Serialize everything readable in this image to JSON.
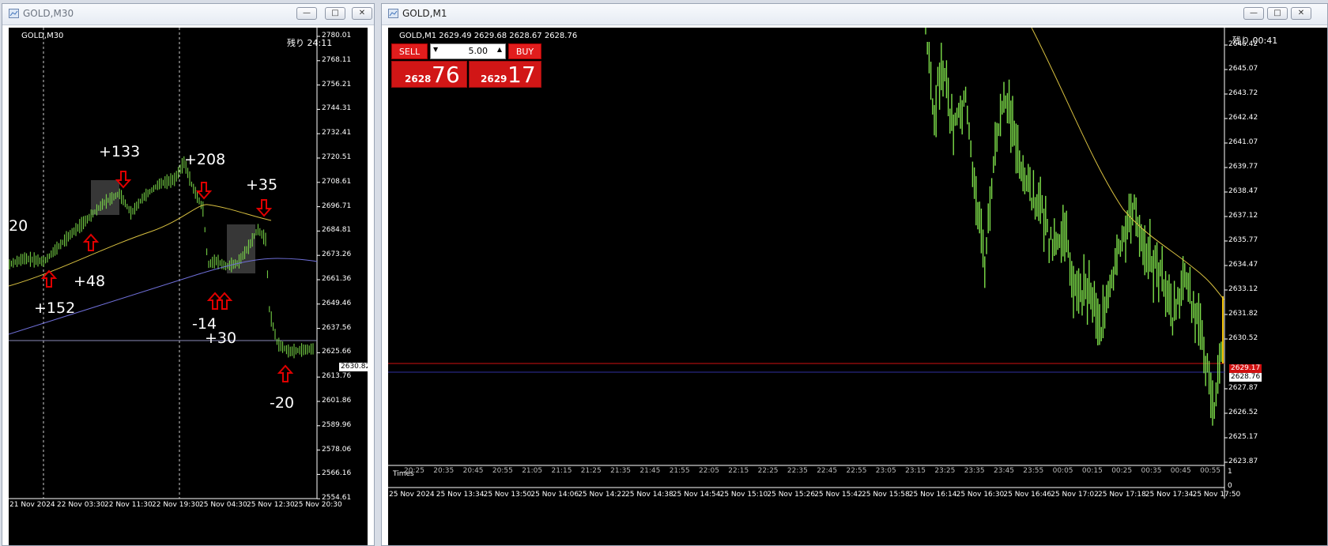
{
  "left_window": {
    "title": "GOLD,M30",
    "chart_label": "GOLD,M30",
    "remaining": "残り 24:11",
    "price_axis": [
      "2780.01",
      "2768.11",
      "2756.21",
      "2744.31",
      "2732.41",
      "2720.51",
      "2708.61",
      "2696.71",
      "2684.81",
      "2673.26",
      "2661.36",
      "2649.46",
      "2637.56",
      "2625.66",
      "2613.76",
      "2601.86",
      "2589.96",
      "2578.06",
      "2566.16",
      "2554.61"
    ],
    "current_price": "2630.82",
    "time_axis": [
      "21 Nov 2024",
      "22 Nov 03:30",
      "22 Nov 11:30",
      "22 Nov 19:30",
      "25 Nov 04:30",
      "25 Nov 12:30",
      "25 Nov 20:30"
    ],
    "annotations": [
      "20",
      "+133",
      "+208",
      "+35",
      "+48",
      "+152",
      "-14",
      "+30",
      "-20"
    ]
  },
  "right_window": {
    "title": "GOLD,M1",
    "chart_label": "GOLD,M1  2629.49 2629.68 2628.67 2628.76",
    "remaining": "残り 00:41",
    "sell_label": "SELL",
    "buy_label": "BUY",
    "volume": "5.00",
    "sell_price_small": "2628",
    "sell_price_big": "76",
    "buy_price_small": "2629",
    "buy_price_big": "17",
    "price_axis": [
      "2646.42",
      "2645.07",
      "2643.72",
      "2642.42",
      "2641.07",
      "2639.77",
      "2638.47",
      "2637.12",
      "2635.77",
      "2634.47",
      "2633.12",
      "2631.82",
      "2630.52",
      "2629.17",
      "2628.76",
      "2627.87",
      "2626.52",
      "2625.17",
      "2623.87"
    ],
    "ask_price_tag": "2629.17",
    "bid_price_tag": "2628.76",
    "subwindow_times": [
      "20:25",
      "20:35",
      "20:45",
      "20:55",
      "21:05",
      "21:15",
      "21:25",
      "21:35",
      "21:45",
      "21:55",
      "22:05",
      "22:15",
      "22:25",
      "22:35",
      "22:45",
      "22:55",
      "23:05",
      "23:15",
      "23:25",
      "23:35",
      "23:45",
      "23:55",
      "00:05",
      "00:15",
      "00:25",
      "00:35",
      "00:45",
      "00:55"
    ],
    "subwindow_title": "Times",
    "subwindow_axis": [
      "1",
      "0"
    ],
    "time_axis": [
      "25 Nov 2024",
      "25 Nov 13:34",
      "25 Nov 13:50",
      "25 Nov 14:06",
      "25 Nov 14:22",
      "25 Nov 14:38",
      "25 Nov 14:54",
      "25 Nov 15:10",
      "25 Nov 15:26",
      "25 Nov 15:42",
      "25 Nov 15:58",
      "25 Nov 16:14",
      "25 Nov 16:30",
      "25 Nov 16:46",
      "25 Nov 17:02",
      "25 Nov 17:18",
      "25 Nov 17:34",
      "25 Nov 17:50"
    ]
  },
  "colors": {
    "candle": "#7ee04a",
    "ma_fast": "#d8c040",
    "ma_slow": "#6f6fd8",
    "arrow": "#e00000",
    "ask_line": "#d01010",
    "bid_line": "#3030a0"
  }
}
